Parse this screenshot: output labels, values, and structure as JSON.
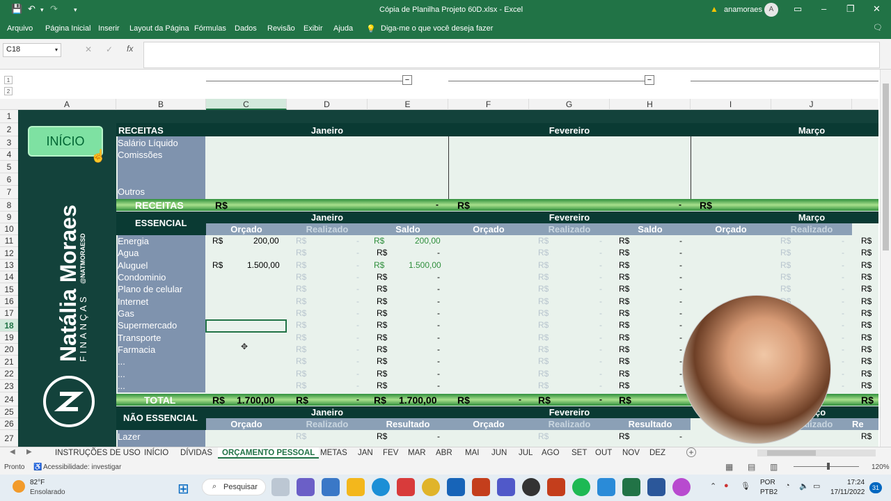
{
  "window": {
    "title": "Cópia de Planilha Projeto 60D.xlsx  -  Excel",
    "user": "anamoraes",
    "user_initial": "A"
  },
  "ribbon": {
    "tabs": [
      "Arquivo",
      "Página Inicial",
      "Inserir",
      "Layout da Página",
      "Fórmulas",
      "Dados",
      "Revisão",
      "Exibir",
      "Ajuda"
    ],
    "tell_me": "Diga-me o que você deseja fazer"
  },
  "formula": {
    "name_box": "C18",
    "fx": "fx",
    "cancel": "✕",
    "enter": "✓"
  },
  "outline": {
    "levels": [
      "1",
      "2"
    ],
    "collapse": "−"
  },
  "columns": [
    "A",
    "B",
    "C",
    "D",
    "E",
    "F",
    "G",
    "H",
    "I",
    "J"
  ],
  "rows": [
    "1",
    "2",
    "3",
    "4",
    "5",
    "6",
    "7",
    "8",
    "9",
    "10",
    "11",
    "12",
    "13",
    "14",
    "15",
    "16",
    "17",
    "18",
    "19",
    "20",
    "21",
    "22",
    "23",
    "24",
    "25",
    "26",
    "27"
  ],
  "brand": {
    "button": "INÍCIO",
    "name": "Natália Moraes",
    "sub": "FINANÇAS",
    "handle": "@NATMORAESD"
  },
  "receitas": {
    "header": "RECEITAS",
    "months": [
      "Janeiro",
      "Fevereiro",
      "Março"
    ],
    "items": [
      "Salário Líquido",
      "Comissões",
      "Outros"
    ],
    "total_label": "RECEITAS",
    "currency": "R$",
    "dash": "-"
  },
  "essencial": {
    "header": "ESSENCIAL",
    "months": [
      "Janeiro",
      "Fevereiro",
      "Março"
    ],
    "cols": [
      "Orçado",
      "Realizado",
      "Saldo",
      "Orçado",
      "Realizado",
      "Saldo",
      "Orçado",
      "Realizado"
    ],
    "items": [
      "Energia",
      "Agua",
      "Aluguel",
      "Condominio",
      "Plano de celular",
      "Internet",
      "Gas",
      "Supermercado",
      "Transporte",
      "Farmacia",
      "...",
      "...",
      "..."
    ],
    "energia_orcado": "200,00",
    "energia_saldo": "200,00",
    "aluguel_orcado": "1.500,00",
    "aluguel_saldo": "1.500,00",
    "total_label": "TOTAL",
    "total_orcado": "1.700,00",
    "total_saldo": "1.700,00"
  },
  "nao_essencial": {
    "header": "NÃO ESSENCIAL",
    "months": [
      "Janeiro",
      "Fevereiro",
      "Março"
    ],
    "cols": [
      "Orçado",
      "Realizado",
      "Resultado",
      "Orçado",
      "Realizado",
      "Resultado",
      "Realizado"
    ],
    "month_partial": "rço",
    "col_partial": "Re",
    "items": [
      "Lazer"
    ]
  },
  "sheets": [
    "INSTRUÇÕES DE USO",
    "INÍCIO",
    "DÍVIDAS",
    "ORÇAMENTO PESSOAL",
    "METAS",
    "JAN",
    "FEV",
    "MAR",
    "ABR",
    "MAI",
    "JUN",
    "JUL",
    "AGO",
    "SET",
    "OUT",
    "NOV",
    "DEZ"
  ],
  "active_sheet": "ORÇAMENTO PESSOAL",
  "status": {
    "ready": "Pronto",
    "accessibility": "Acessibilidade: investigar",
    "zoom": "120%"
  },
  "taskbar": {
    "weather_temp": "82°F",
    "weather_desc": "Ensolarado",
    "search": "Pesquisar",
    "lang": "POR",
    "layout": "PTB2",
    "time": "17:24",
    "date": "17/11/2022",
    "badge": "31"
  },
  "colors": {
    "excel_green": "#217346",
    "sidebar": "#13423b",
    "band_dark": "#0a3a33",
    "band_green": "#2f8f3c",
    "label_col": "#7f93ae"
  }
}
